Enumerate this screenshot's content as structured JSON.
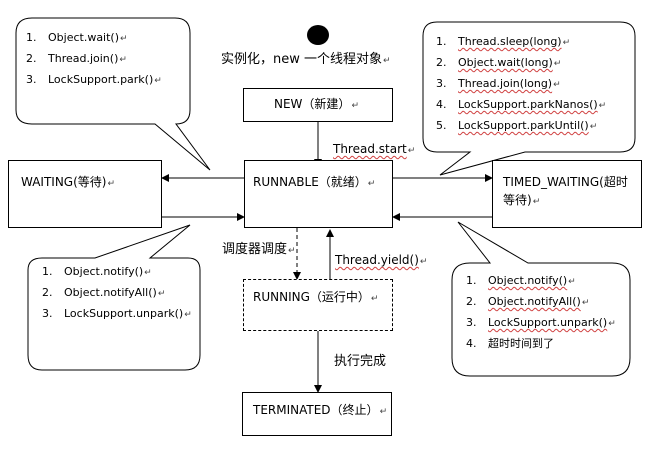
{
  "start_label": "实例化，new 一个线程对象",
  "states": {
    "new": "NEW（新建）",
    "runnable": "RUNNABLE（就绪）",
    "running": "RUNNING（运行中）",
    "terminated": "TERMINATED（终止）",
    "waiting": "WAITING(等待)",
    "timed_waiting_1": "TIMED_WAITING(超时",
    "timed_waiting_2": "等待)"
  },
  "edge_labels": {
    "thread_start": "Thread.start",
    "scheduler": "调度器调度",
    "thread_yield": "Thread.yield()",
    "execution_done": "执行完成"
  },
  "notes": {
    "waiting_enter": [
      "Object.wait()",
      "Thread.join()",
      "LockSupport.park()"
    ],
    "waiting_exit": [
      "Object.notify()",
      "Object.notifyAll()",
      "LockSupport.unpark()"
    ],
    "timed_enter": [
      "Thread.sleep(long)",
      "Object.wait(long)",
      "Thread.join(long)",
      "LockSupport.parkNanos()",
      "LockSupport.parkUntil()"
    ],
    "timed_exit": [
      "Object.notify()",
      "Object.notifyAll()",
      "LockSupport.unpark()",
      "超时时间到了"
    ]
  },
  "numbers": [
    "1.",
    "2.",
    "3.",
    "4.",
    "5."
  ],
  "return_mark": "↵"
}
